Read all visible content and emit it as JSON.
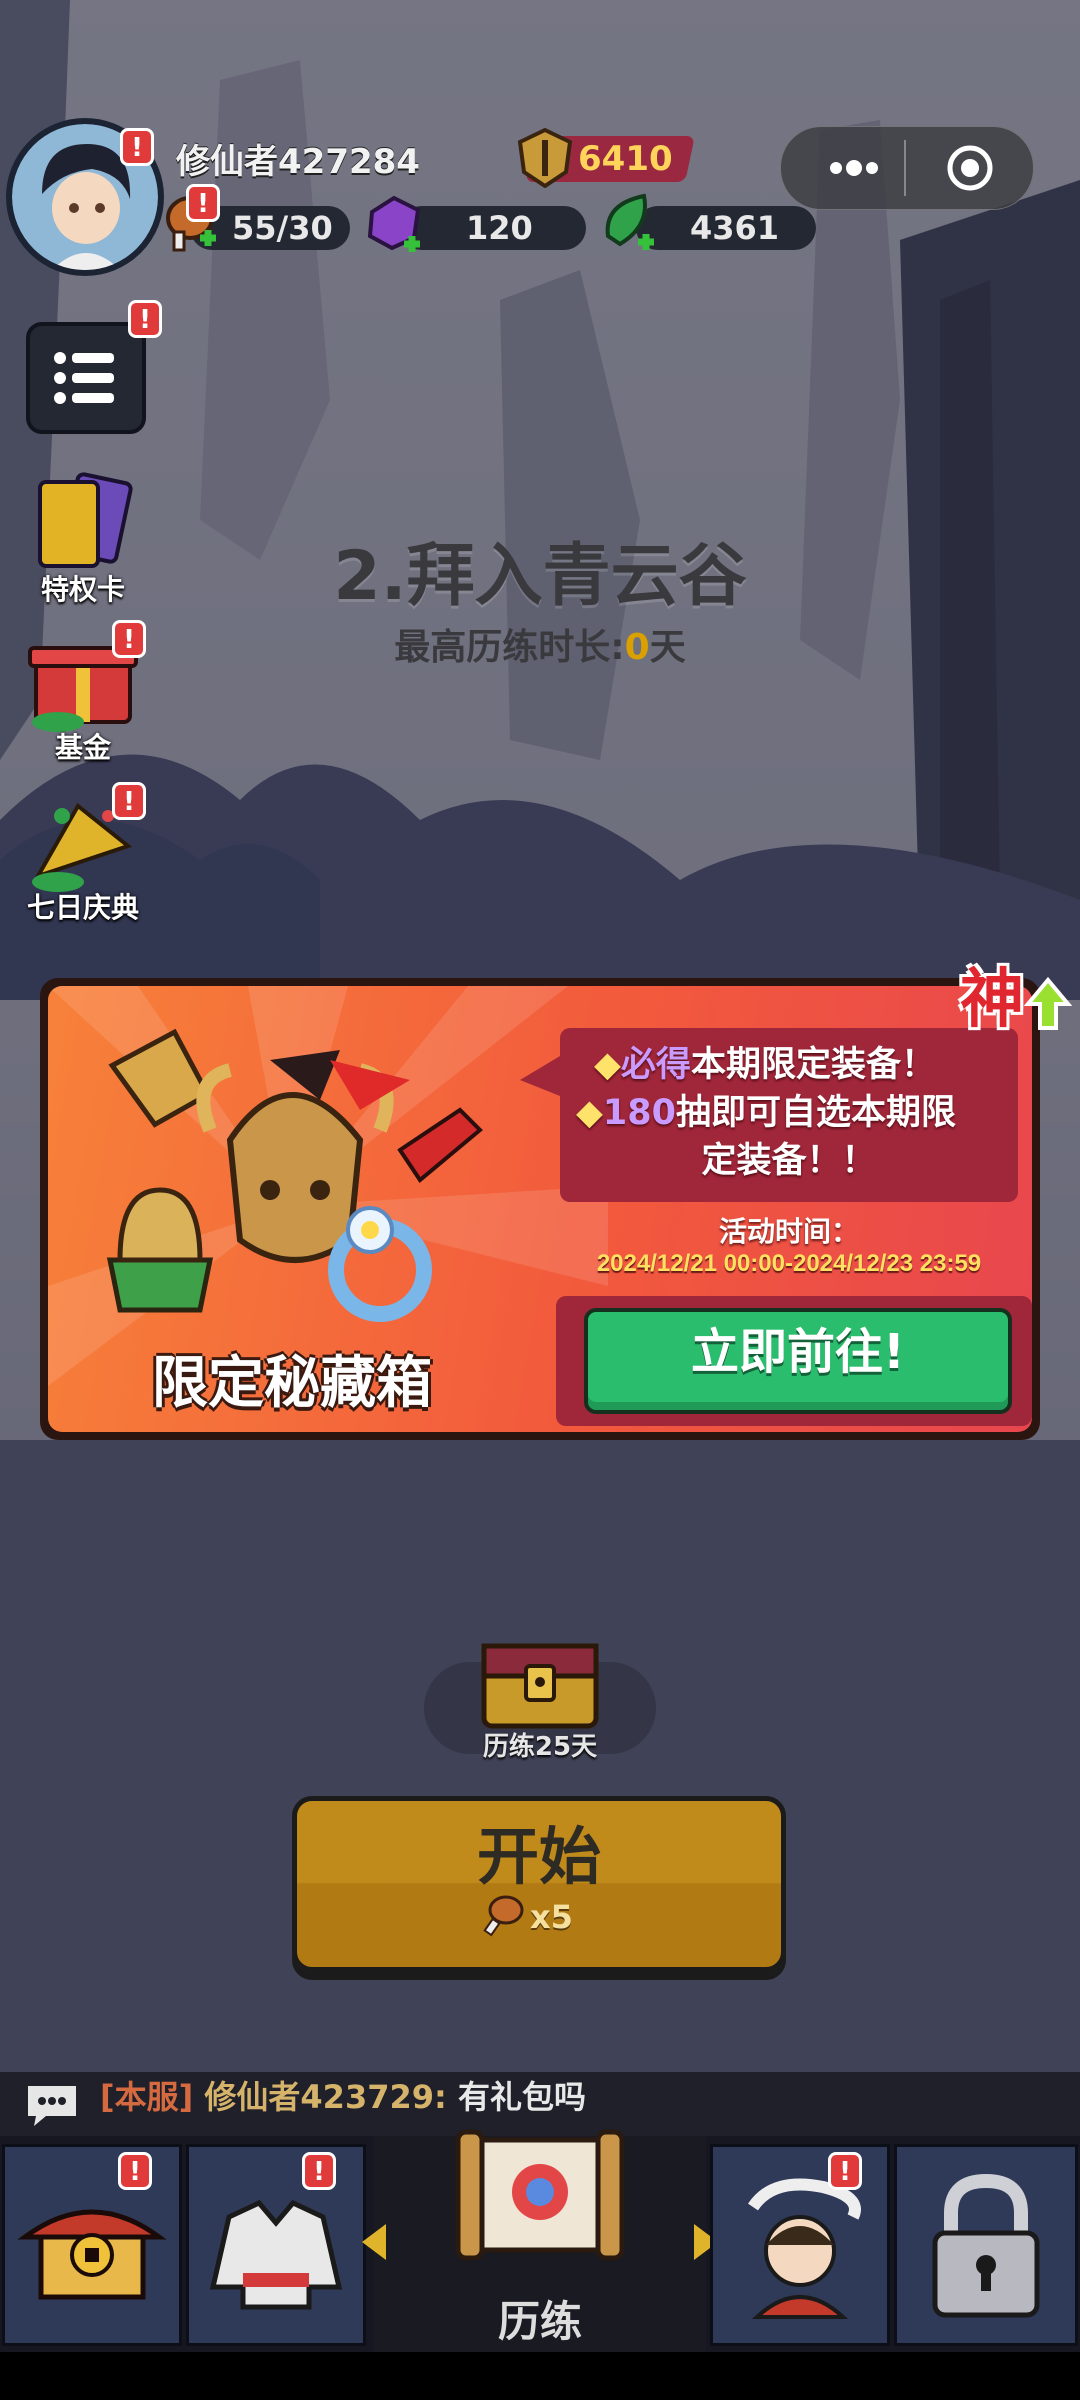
{
  "player": {
    "name": "修仙者427284"
  },
  "currency": {
    "gold": "6410"
  },
  "resources": [
    {
      "icon": "drumstick-icon",
      "value": "55/30"
    },
    {
      "icon": "purple-gem-icon",
      "value": "120"
    },
    {
      "icon": "jade-leaf-icon",
      "value": "4361"
    }
  ],
  "side_menu": [
    {
      "icon": "privilege-card-icon",
      "label": "特权卡"
    },
    {
      "icon": "fund-giftbox-icon",
      "label": "基金"
    },
    {
      "icon": "celebration-icon",
      "label": "七日庆典"
    }
  ],
  "stage": {
    "title": "2.拜入青云谷",
    "best_prefix": "最高历练时长:",
    "best_value": "0",
    "best_suffix": "天"
  },
  "banner": {
    "box_title": "限定秘藏箱",
    "line1_diamond": "◆",
    "line1_highlight": "必得",
    "line1_rest": "本期限定装备！",
    "line2_diamond": "◆",
    "line2_highlight": "180",
    "line2_rest": "抽即可自选本期限",
    "line3": "定装备！！",
    "activity_label": "活动时间：",
    "activity_time": "2024/12/21 00:00-2024/12/23 23:59",
    "go_button": "立即前往!",
    "god_badge": "神"
  },
  "chest": {
    "label": "历练25天"
  },
  "start": {
    "label": "开始",
    "cost": "x5"
  },
  "chat": {
    "server": "[本服]",
    "user": "修仙者423729:",
    "message": "有礼包吗"
  },
  "nav": {
    "center_label": "历练"
  },
  "colors": {
    "accent_gold": "#c08b1b",
    "go_green": "#2bbd6e",
    "alert_red": "#e03a3a",
    "banner_orange": "#f7813a"
  }
}
